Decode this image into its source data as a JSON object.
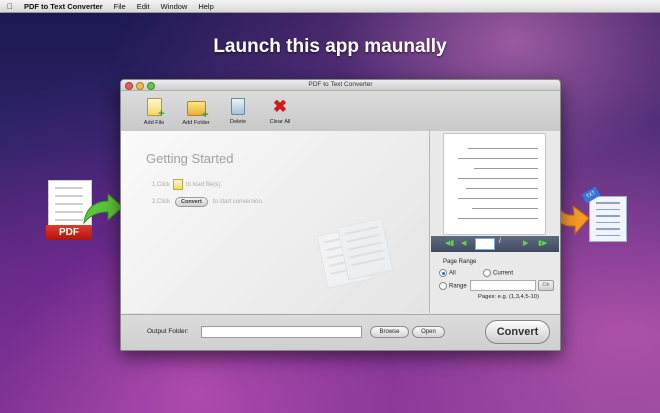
{
  "menubar": {
    "app_name": "PDF to Text Converter",
    "items": [
      "File",
      "Edit",
      "Window",
      "Help"
    ]
  },
  "headline": "Launch this app maunally",
  "window": {
    "title": "PDF to Text Converter",
    "toolbar": {
      "add_file": "Add File",
      "add_folder": "Add Folder",
      "delete": "Delete",
      "clear_all": "Clear All"
    },
    "getting_started": {
      "title": "Getting Started",
      "step1_prefix": "1.Click",
      "step1_suffix": "to load file(s).",
      "step2_prefix": "2.Click",
      "step2_button": "Convert",
      "step2_suffix": "to start conversion."
    },
    "navigator": {
      "page_value": "",
      "separator": "/"
    },
    "page_range": {
      "title": "Page Range",
      "all_label": "All",
      "current_label": "Current",
      "range_label": "Range",
      "range_value": "",
      "ok_label": "Ok",
      "hint": "Pages: e.g. (1,3,4,5-10)",
      "selected": "All"
    },
    "bottom": {
      "output_folder_label": "Output Folder:",
      "output_folder_value": "",
      "browse_label": "Browse",
      "open_label": "Open",
      "convert_label": "Convert"
    }
  },
  "decor": {
    "pdf_icon_label": "PDF",
    "txt_icon_label": "TXT"
  },
  "colors": {
    "arrow_green": "#5cc53a",
    "arrow_orange": "#f59a26",
    "pdf_red": "#d0281a",
    "nav_bar": "#4a556b"
  }
}
